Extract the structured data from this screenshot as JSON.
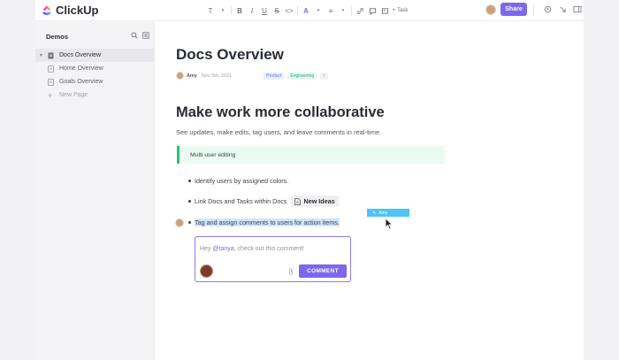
{
  "app": {
    "name": "ClickUp",
    "brand_color": "#7b68ee"
  },
  "toolbar": {
    "text_style": "T",
    "bold": "B",
    "italic": "I",
    "underline": "U",
    "strike": "S",
    "code": "<>",
    "color": "A",
    "align": "≡",
    "task_label": "+ Task",
    "share_label": "Share"
  },
  "sidebar": {
    "title": "Demos",
    "items": [
      {
        "label": "Docs Overview",
        "active": true
      },
      {
        "label": "Home Overview",
        "active": false
      },
      {
        "label": "Goals Overview",
        "active": false
      }
    ],
    "new_page": "New Page"
  },
  "doc": {
    "title": "Docs Overview",
    "author": "Amy",
    "date": "Nov 5th, 2021",
    "tags": [
      "Product",
      "Engineering"
    ],
    "tag_add": "+",
    "heading": "Make work more collaborative",
    "subtitle": "See updates, make edits, tag users, and leave comments in real-time.",
    "callout": "Multi user editing",
    "bullets": [
      "Identify users by assigned colors.",
      "Link Docs and Tasks within Docs",
      "Tag and assign comments to users for action items."
    ],
    "linked_chip": "New Ideas",
    "cursor_user": "Amy"
  },
  "comment": {
    "prefix": "Hey ",
    "mention": "@tanya",
    "suffix": ", check out this comment!",
    "button": "COMMENT"
  }
}
